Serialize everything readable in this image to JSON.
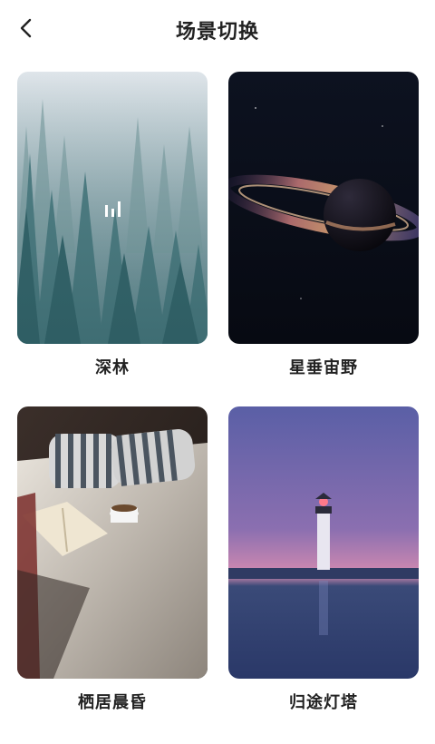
{
  "header": {
    "title": "场景切换",
    "back_icon": "chevron-left-icon"
  },
  "scenes": [
    {
      "label": "深林",
      "active": true,
      "indicator_icon": "audio-bars-icon"
    },
    {
      "label": "星垂宙野",
      "active": false
    },
    {
      "label": "栖居晨昏",
      "active": false
    },
    {
      "label": "归途灯塔",
      "active": false
    }
  ],
  "colors": {
    "text": "#222222",
    "background": "#ffffff"
  }
}
